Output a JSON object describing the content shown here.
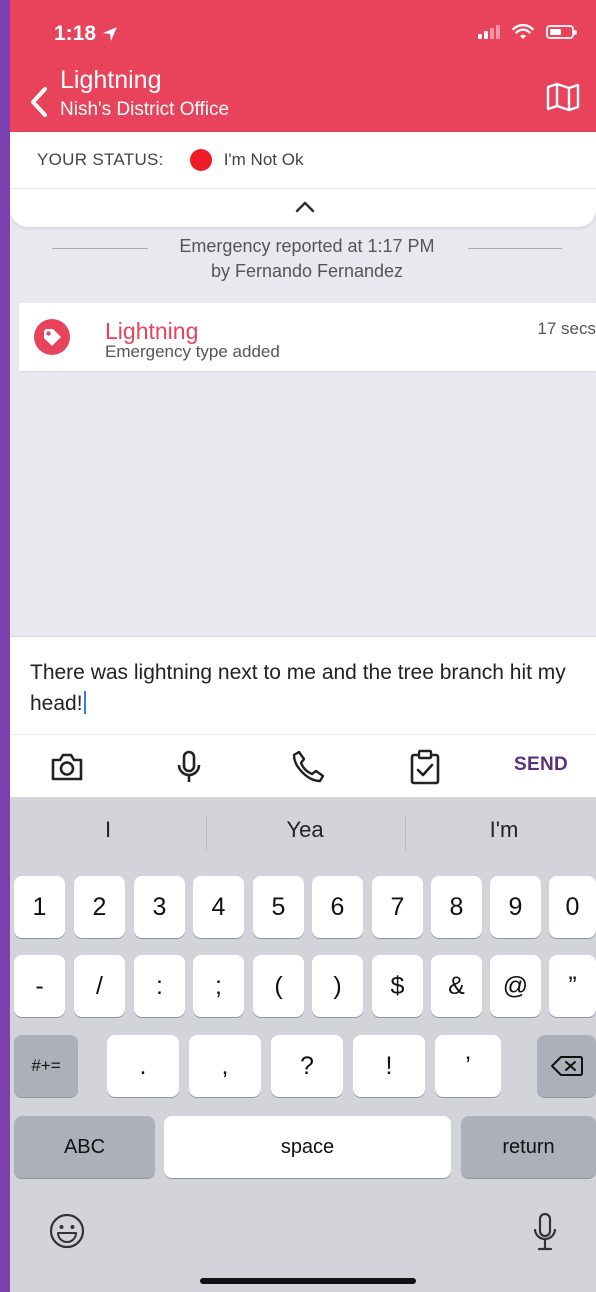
{
  "status_bar": {
    "time": "1:18"
  },
  "header": {
    "title": "Lightning",
    "subtitle": "Nish's District Office",
    "brand_color": "#e8435a"
  },
  "status": {
    "label": "YOUR STATUS:",
    "value": "I'm Not Ok",
    "dot_color": "#ee1c25"
  },
  "feed": {
    "event_line1": "Emergency reported at 1:17 PM",
    "event_line2": "by Fernando Fernandez",
    "card": {
      "title": "Lightning",
      "subtitle": "Emergency type added",
      "time": "17 secs"
    }
  },
  "composer": {
    "text": "There was lightning next to me and the tree branch hit my head!"
  },
  "actions": {
    "icons": [
      "camera-icon",
      "microphone-icon",
      "phone-icon",
      "clipboard-check-icon"
    ],
    "send": "SEND"
  },
  "keyboard": {
    "suggestions": [
      "I",
      "Yea",
      "I'm"
    ],
    "row1": [
      "1",
      "2",
      "3",
      "4",
      "5",
      "6",
      "7",
      "8",
      "9",
      "0"
    ],
    "row2": [
      "-",
      "/",
      ":",
      ";",
      "(",
      ")",
      "$",
      "&",
      "@",
      "”"
    ],
    "row3_left": "#+=",
    "row3": [
      ".",
      ",",
      "?",
      "!",
      "’"
    ],
    "abc": "ABC",
    "space": "space",
    "return": "return"
  }
}
